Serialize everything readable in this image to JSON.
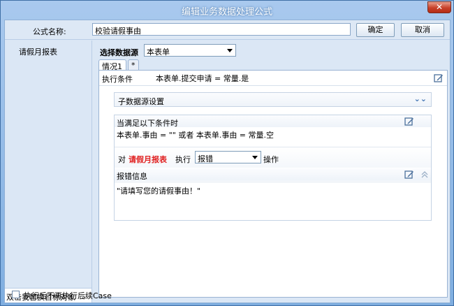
{
  "window": {
    "title": "编辑业务数据处理公式",
    "close_label": "✕"
  },
  "header": {
    "name_label": "公式名称:",
    "name_value": "校验请假事由",
    "ok_label": "确定",
    "cancel_label": "取消"
  },
  "sidebar": {
    "items": [
      {
        "label": "请假月报表"
      }
    ],
    "footer_text": "双击我替换目标对象",
    "footer_more": "..."
  },
  "datasource": {
    "label": "选择数据源",
    "selected": "本表单"
  },
  "tabs": [
    {
      "label": "情况1"
    },
    {
      "label": "*"
    }
  ],
  "condition": {
    "label": "执行条件",
    "value": "本表单.提交申请 = 常量.是"
  },
  "sub_datasource": {
    "label": "子数据源设置"
  },
  "rule": {
    "when_label": "当满足以下条件时",
    "condition_text": "本表单.事由 = \"\" 或者 本表单.事由 = 常量.空",
    "dui_label": "对",
    "target": "请假月报表",
    "exec_label": "执行",
    "action_selected": "报错",
    "op_label": "操作",
    "error_header": "报错信息",
    "error_message": "\"请填写您的请假事由！\""
  },
  "options": {
    "no_subsequent_label": "执行后不再执行后续Case"
  }
}
